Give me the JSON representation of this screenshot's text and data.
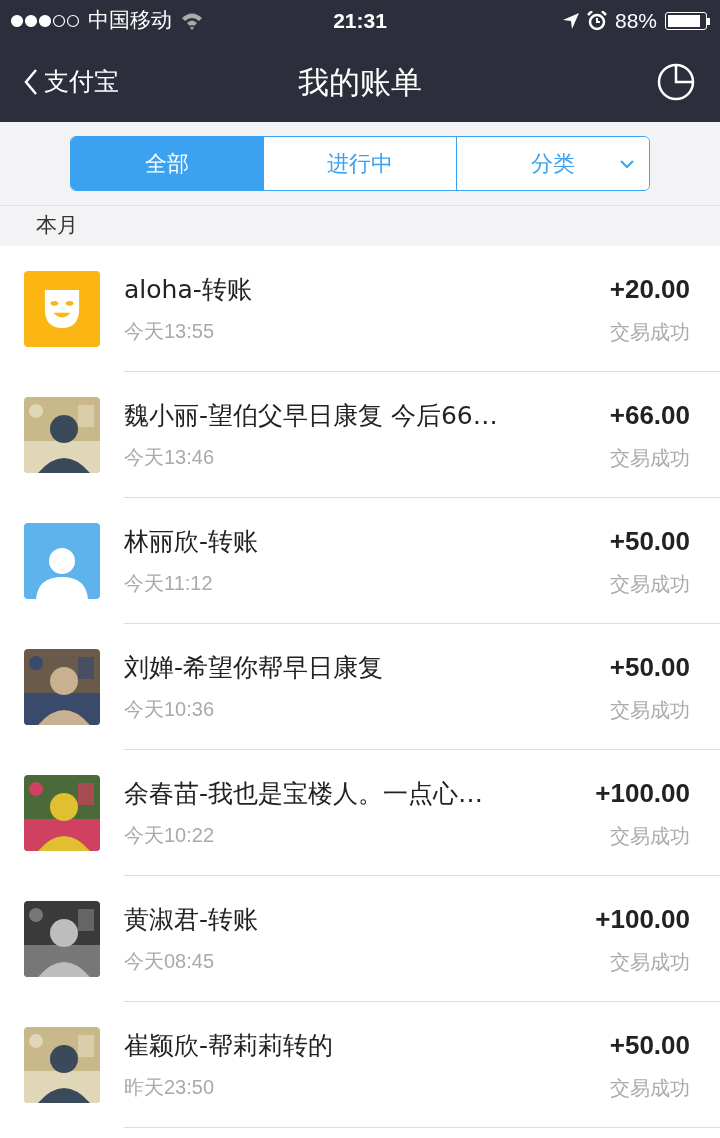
{
  "status_bar": {
    "carrier": "中国移动",
    "time": "21:31",
    "battery": "88%"
  },
  "nav": {
    "back": "支付宝",
    "title": "我的账单"
  },
  "tabs": [
    {
      "label": "全部",
      "selected": true,
      "has_menu": false
    },
    {
      "label": "进行中",
      "selected": false,
      "has_menu": false
    },
    {
      "label": "分类",
      "selected": false,
      "has_menu": true
    }
  ],
  "section": "本月",
  "rows": [
    {
      "kind": "mask",
      "title": "aloha-转账",
      "time": "今天13:55",
      "amount": "+20.00",
      "status": "交易成功"
    },
    {
      "kind": "picture",
      "title": "魏小丽-望伯父早日康复 今后66…",
      "time": "今天13:46",
      "amount": "+66.00",
      "status": "交易成功"
    },
    {
      "kind": "person",
      "title": "林丽欣-转账",
      "time": "今天11:12",
      "amount": "+50.00",
      "status": "交易成功"
    },
    {
      "kind": "picture",
      "title": "刘婵-希望你帮早日康复",
      "time": "今天10:36",
      "amount": "+50.00",
      "status": "交易成功"
    },
    {
      "kind": "picture",
      "title": "余春苗-我也是宝楼人。一点心…",
      "time": "今天10:22",
      "amount": "+100.00",
      "status": "交易成功"
    },
    {
      "kind": "picture",
      "title": "黄淑君-转账",
      "time": "今天08:45",
      "amount": "+100.00",
      "status": "交易成功"
    },
    {
      "kind": "picture",
      "title": "崔颖欣-帮莉莉转的",
      "time": "昨天23:50",
      "amount": "+50.00",
      "status": "交易成功"
    }
  ]
}
